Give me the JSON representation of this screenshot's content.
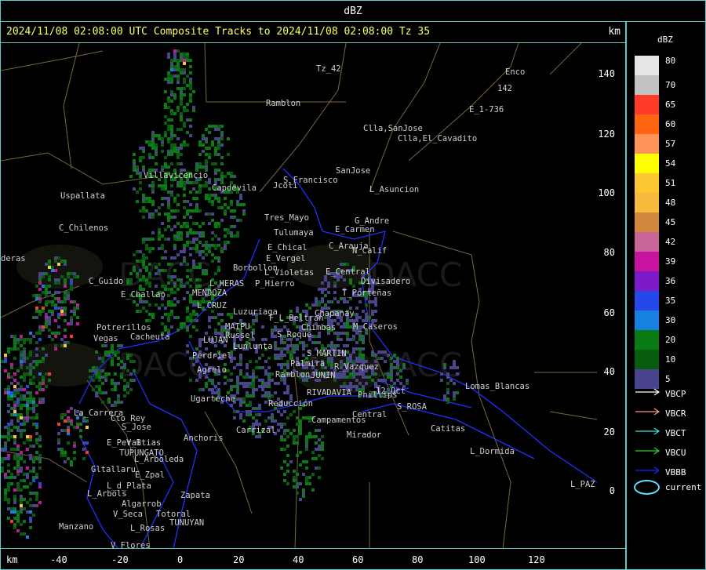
{
  "window_title": "dBZ",
  "header": {
    "text": "2024/11/08 02:08:00 UTC Composite Tracks to 2024/11/08 02:08:00 Tz 35",
    "unit": "km"
  },
  "axes": {
    "x_label": "km",
    "x_ticks": [
      "-40",
      "-20",
      "0",
      "20",
      "40",
      "60",
      "80",
      "100",
      "120"
    ],
    "y_ticks": [
      "140",
      "120",
      "100",
      "80",
      "60",
      "40",
      "20",
      "0"
    ]
  },
  "legend": {
    "title": "dBZ",
    "scale": [
      {
        "label": "80",
        "color": "#e6e6e6"
      },
      {
        "label": "70",
        "color": "#c2c2c2"
      },
      {
        "label": "65",
        "color": "#ff3a26"
      },
      {
        "label": "60",
        "color": "#ff6410"
      },
      {
        "label": "57",
        "color": "#ff9459"
      },
      {
        "label": "54",
        "color": "#ffff00"
      },
      {
        "label": "51",
        "color": "#fcc730"
      },
      {
        "label": "48",
        "color": "#f6ba3c"
      },
      {
        "label": "45",
        "color": "#d0873e"
      },
      {
        "label": "42",
        "color": "#c86496"
      },
      {
        "label": "39",
        "color": "#c812a0"
      },
      {
        "label": "36",
        "color": "#7c1ac8"
      },
      {
        "label": "35",
        "color": "#2448ea"
      },
      {
        "label": "30",
        "color": "#1880e0"
      },
      {
        "label": "20",
        "color": "#0a7a14"
      },
      {
        "label": "10",
        "color": "#075c10"
      },
      {
        "label": "5",
        "color": "#4a448c"
      }
    ],
    "tracks": [
      {
        "label": "VBCP",
        "color": "#ffffff"
      },
      {
        "label": "VBCR",
        "color": "#ff9a7a"
      },
      {
        "label": "VBCT",
        "color": "#40e0e0"
      },
      {
        "label": "VBCU",
        "color": "#30d030"
      },
      {
        "label": "VBBB",
        "color": "#2020ff"
      }
    ],
    "current_label": "current"
  },
  "places": [
    "Ramblon",
    "Enco",
    "E_1-736",
    "Clla,SanJose",
    "Clla,El_Cavadito",
    "S_Francisco",
    "SanJose",
    "Jcoli",
    "L_Asuncion",
    "Uspallata",
    "Capdevila",
    "Villavicencio",
    "Tres_Mayo",
    "G_Andre",
    "Tulumaya",
    "E_Carmen",
    "C_Chilenos",
    "E_Chical",
    "C_Arauja",
    "N_Calif",
    "E_Vergel",
    "Borbollon",
    "Divisadero",
    "C_Guido",
    "L_HERAS",
    "P_Hierro",
    "L_Violetas",
    "E_Central",
    "E_Challao",
    "MENDOZA",
    "T_Porteñas",
    "L_CRUZ",
    "Luzuriaga",
    "Chapanay",
    "Potrerillos",
    "MAIPU",
    "F_L_Beltran",
    "Chimbas",
    "M_Caseros",
    "Vegas",
    "Cacheuta",
    "LUJAN",
    "Russel",
    "S_Roque",
    "Lunlunta",
    "Perdriel",
    "S_MARTIN",
    "Agrelo",
    "Palmira",
    "R_Vazquez",
    "JUNIN",
    "Ramblon",
    "Lomas_Blancas",
    "Ugarteche",
    "RIVADAVIA",
    "Phillips",
    "12_Oct",
    "La_Carrera",
    "Cto_Rey",
    "Reducción",
    "S_ROSA",
    "Carrizal",
    "Central",
    "Campamentos",
    "S_Jose",
    "Anchoris",
    "Mirador",
    "Catitas",
    "E_Peral",
    "V_Btias",
    "TUPUNGATO",
    "L_Dormida",
    "L_Arboleda",
    "Gltallaru",
    "E_Zpal",
    "L_d_Plata",
    "Zapata",
    "L_PAZ",
    "L_Arbols",
    "Algarrob",
    "V_Seca",
    "Totoral",
    "Manzano",
    "L_Rosas",
    "TUNUYAN",
    "V_Flores",
    "Tz_42",
    "142",
    "deras"
  ]
}
